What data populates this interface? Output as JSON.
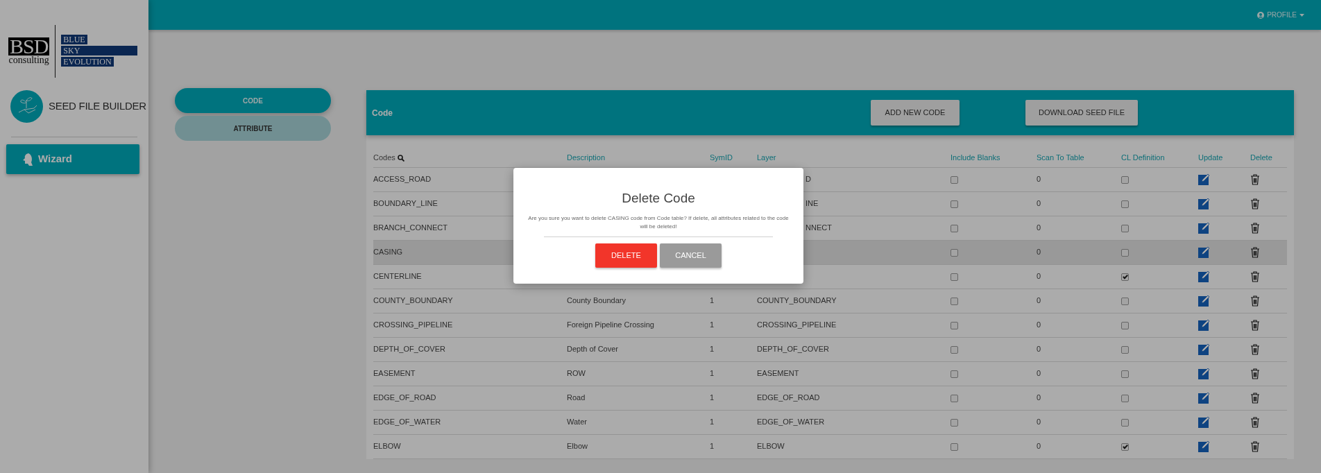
{
  "logo": {
    "mark": "BSD",
    "sub": "consulting",
    "lines": [
      "BLUE",
      "SKY",
      "EVOLUTION"
    ]
  },
  "app": {
    "title": "SEED FILE BUILDER"
  },
  "sidebar": {
    "items": [
      {
        "label": "Wizard",
        "selected": true
      }
    ]
  },
  "topbar": {
    "profile": "PROFILE"
  },
  "tabs": [
    {
      "label": "CODE",
      "selected": true
    },
    {
      "label": "ATTRIBUTE",
      "selected": false
    }
  ],
  "panel": {
    "title": "Code",
    "buttons": [
      "ADD NEW CODE",
      "DOWNLOAD SEED FILE"
    ]
  },
  "table": {
    "columns": [
      "Codes",
      "Description",
      "SymID",
      "Layer",
      "Include Blanks",
      "Scan To Table",
      "CL Definition",
      "Update",
      "Delete"
    ],
    "rows": [
      {
        "code": "ACCESS_ROAD",
        "layer": "D",
        "covered": true,
        "include_blanks": false,
        "scan": "0",
        "cl_definition": false,
        "selected": false
      },
      {
        "code": "BOUNDARY_LINE",
        "layer": "INE",
        "covered": true,
        "include_blanks": false,
        "scan": "0",
        "cl_definition": false,
        "selected": false
      },
      {
        "code": "BRANCH_CONNECT",
        "layer": "NNECT",
        "covered": true,
        "include_blanks": false,
        "scan": "0",
        "cl_definition": false,
        "selected": false
      },
      {
        "code": "CASING",
        "include_blanks": false,
        "scan": "0",
        "cl_definition": false,
        "selected": true
      },
      {
        "code": "CENTERLINE",
        "include_blanks": false,
        "scan": "0",
        "cl_definition": true,
        "selected": false
      },
      {
        "code": "COUNTY_BOUNDARY",
        "description": "County Boundary",
        "symid": "1",
        "layer": "COUNTY_BOUNDARY",
        "include_blanks": false,
        "scan": "0",
        "cl_definition": false,
        "selected": false
      },
      {
        "code": "CROSSING_PIPELINE",
        "description": "Foreign Pipeline Crossing",
        "symid": "1",
        "layer": "CROSSING_PIPELINE",
        "include_blanks": false,
        "scan": "0",
        "cl_definition": false,
        "selected": false
      },
      {
        "code": "DEPTH_OF_COVER",
        "description": "Depth of Cover",
        "symid": "1",
        "layer": "DEPTH_OF_COVER",
        "include_blanks": false,
        "scan": "0",
        "cl_definition": false,
        "selected": false
      },
      {
        "code": "EASEMENT",
        "description": "ROW",
        "symid": "1",
        "layer": "EASEMENT",
        "include_blanks": false,
        "scan": "0",
        "cl_definition": false,
        "selected": false
      },
      {
        "code": "EDGE_OF_ROAD",
        "description": "Road",
        "symid": "1",
        "layer": "EDGE_OF_ROAD",
        "include_blanks": false,
        "scan": "0",
        "cl_definition": false,
        "selected": false
      },
      {
        "code": "EDGE_OF_WATER",
        "description": "Water",
        "symid": "1",
        "layer": "EDGE_OF_WATER",
        "include_blanks": false,
        "scan": "0",
        "cl_definition": false,
        "selected": false
      },
      {
        "code": "ELBOW",
        "description": "Elbow",
        "symid": "1",
        "layer": "ELBOW",
        "include_blanks": false,
        "scan": "0",
        "cl_definition": true,
        "selected": false
      }
    ]
  },
  "dialog": {
    "title": "Delete Code",
    "message": "Are you sure you want to delete CASING code from Code table? If delete, all attributes related to the code will be deleted!",
    "buttons": [
      {
        "label": "DELETE",
        "kind": "danger"
      },
      {
        "label": "CANCEL",
        "kind": "secondary"
      }
    ]
  }
}
